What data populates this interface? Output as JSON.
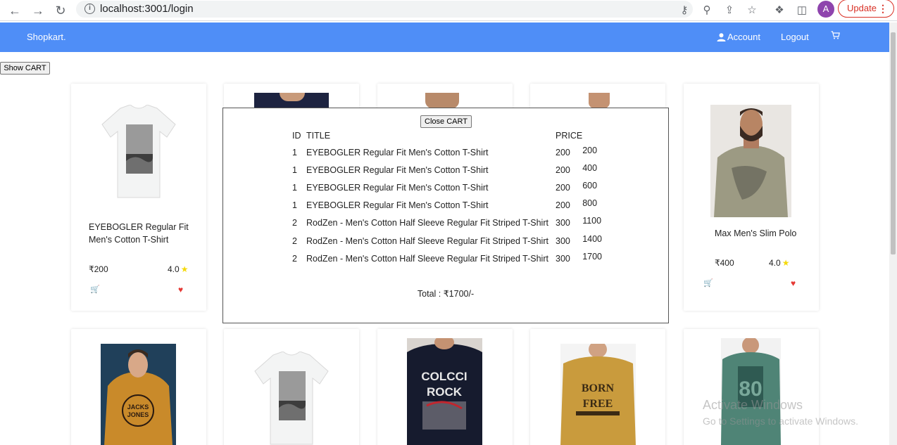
{
  "browser": {
    "url": "localhost:3001/login",
    "update_label": "Update"
  },
  "navbar": {
    "brand": "Shopkart.",
    "account": "Account",
    "logout": "Logout"
  },
  "show_cart_label": "Show CART",
  "products": [
    {
      "title": "EYEBOGLER Regular Fit Men's Cotton T-Shirt",
      "price": "₹200",
      "rating": "4.0"
    },
    {
      "title": "Max Men's Slim Polo",
      "price": "₹400",
      "rating": "4.0"
    }
  ],
  "cart": {
    "close_label": "Close CART",
    "headers": {
      "id": "ID",
      "title": "TITLE",
      "price": "PRICE"
    },
    "rows": [
      {
        "id": "1",
        "title": "EYEBOGLER Regular Fit Men's Cotton T-Shirt",
        "price": "200",
        "running": "200"
      },
      {
        "id": "1",
        "title": "EYEBOGLER Regular Fit Men's Cotton T-Shirt",
        "price": "200",
        "running": "400"
      },
      {
        "id": "1",
        "title": "EYEBOGLER Regular Fit Men's Cotton T-Shirt",
        "price": "200",
        "running": "600"
      },
      {
        "id": "1",
        "title": "EYEBOGLER Regular Fit Men's Cotton T-Shirt",
        "price": "200",
        "running": "800"
      },
      {
        "id": "2",
        "title": "RodZen - Men's Cotton Half Sleeve Regular Fit Striped T-Shirt",
        "price": "300",
        "running": "1100"
      },
      {
        "id": "2",
        "title": "RodZen - Men's Cotton Half Sleeve Regular Fit Striped T-Shirt",
        "price": "300",
        "running": "1400"
      },
      {
        "id": "2",
        "title": "RodZen - Men's Cotton Half Sleeve Regular Fit Striped T-Shirt",
        "price": "300",
        "running": "1700"
      }
    ],
    "total": "Total : ₹1700/-"
  },
  "watermark": {
    "line1": "Activate Windows",
    "line2": "Go to Settings to activate Windows."
  }
}
